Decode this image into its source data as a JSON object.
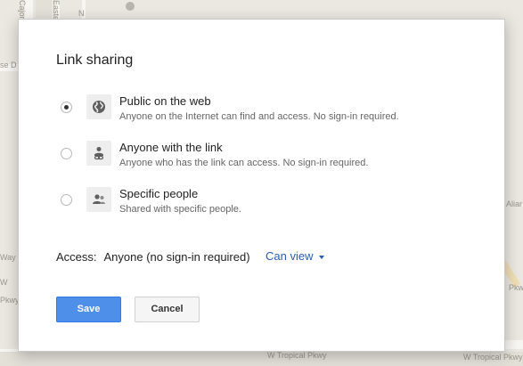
{
  "background": {
    "map_labels": [
      "Cajon",
      "Eastern",
      "N",
      "W Tropical Pkwy",
      "W Tropical Pkwy",
      "Aliar",
      "Pkwy",
      "W",
      "Way",
      "Pkwy",
      "se D"
    ]
  },
  "dialog": {
    "title": "Link sharing",
    "options": [
      {
        "label": "Public on the web",
        "description": "Anyone on the Internet can find and access. No sign-in required.",
        "icon": "globe-icon",
        "selected": true
      },
      {
        "label": "Anyone with the link",
        "description": "Anyone who has the link can access. No sign-in required.",
        "icon": "link-person-icon",
        "selected": false
      },
      {
        "label": "Specific people",
        "description": "Shared with specific people.",
        "icon": "people-icon",
        "selected": false
      }
    ],
    "access": {
      "label": "Access:",
      "value": "Anyone (no sign-in required)",
      "permission": "Can view"
    },
    "buttons": {
      "save": "Save",
      "cancel": "Cancel"
    }
  },
  "colors": {
    "primary_button": "#4d8fe9",
    "link": "#2a5db0"
  }
}
